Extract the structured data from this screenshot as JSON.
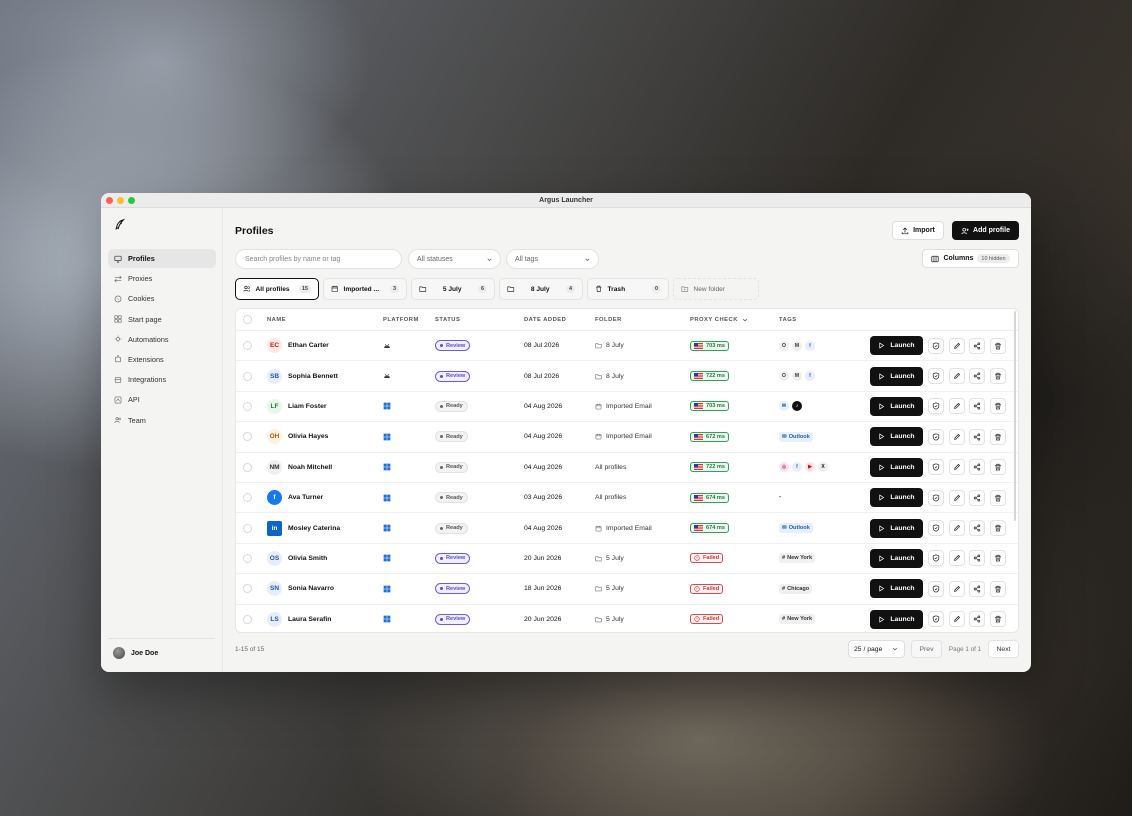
{
  "window": {
    "title": "Argus Launcher"
  },
  "sidebar": {
    "items": [
      {
        "label": "Profiles",
        "icon": "monitor-icon",
        "active": true
      },
      {
        "label": "Proxies",
        "icon": "proxy-icon"
      },
      {
        "label": "Cookies",
        "icon": "cookie-icon"
      },
      {
        "label": "Start page",
        "icon": "grid-icon"
      },
      {
        "label": "Automations",
        "icon": "automation-icon"
      },
      {
        "label": "Extensions",
        "icon": "extension-icon"
      },
      {
        "label": "Integrations",
        "icon": "integration-icon"
      },
      {
        "label": "API",
        "icon": "api-icon"
      },
      {
        "label": "Team",
        "icon": "team-icon"
      }
    ],
    "user": "Joe Doe"
  },
  "header": {
    "title": "Profiles",
    "import_label": "Import",
    "add_label": "Add profile",
    "columns_label": "Columns",
    "hidden_label": "10 hidden"
  },
  "filters": {
    "search_placeholder": "Search profiles by name or tag",
    "status_select": "All statuses",
    "tags_select": "All tags"
  },
  "folders": [
    {
      "label": "All profiles",
      "count": "15",
      "icon": "users-icon",
      "active": true
    },
    {
      "label": "Imported ...",
      "count": "3",
      "icon": "calendar-icon"
    },
    {
      "label": "5 July",
      "count": "6",
      "icon": "folder-icon"
    },
    {
      "label": "8 July",
      "count": "4",
      "icon": "folder-icon"
    },
    {
      "label": "Trash",
      "count": "0",
      "icon": "trash-icon"
    },
    {
      "label": "New folder",
      "icon": "folder-plus-icon"
    }
  ],
  "table": {
    "headers": [
      "NAME",
      "PLATFORM",
      "STATUS",
      "DATE ADDED",
      "FOLDER",
      "PROXY CHECK",
      "TAGS"
    ],
    "rows": [
      {
        "initials": "EC",
        "avatarColor": "#fde8e8",
        "initialsColor": "#b42318",
        "name": "Ethan Carter",
        "platform": "android",
        "status": "Review",
        "date": "08 Jul 2026",
        "folder": "8 July",
        "folderIcon": "folder",
        "proxy": "703 ms",
        "proxyOk": true,
        "tags": [
          {
            "kind": "circle",
            "text": "O",
            "bg": "#efefef",
            "fg": "#333"
          },
          {
            "kind": "circle",
            "text": "M",
            "bg": "#efefef",
            "fg": "#333"
          },
          {
            "kind": "circle",
            "text": "f",
            "bg": "#e7f0fc",
            "fg": "#1877f2"
          }
        ],
        "launch": "Launch"
      },
      {
        "initials": "SB",
        "avatarColor": "#e7eefb",
        "initialsColor": "#2451a6",
        "name": "Sophia Bennett",
        "platform": "android",
        "status": "Review",
        "date": "08 Jul 2026",
        "folder": "8 July",
        "folderIcon": "folder",
        "proxy": "722 ms",
        "proxyOk": true,
        "tags": [
          {
            "kind": "circle",
            "text": "O",
            "bg": "#efefef",
            "fg": "#333"
          },
          {
            "kind": "circle",
            "text": "M",
            "bg": "#efefef",
            "fg": "#333"
          },
          {
            "kind": "circle",
            "text": "f",
            "bg": "#e7f0fc",
            "fg": "#1877f2"
          }
        ],
        "launch": "Launch"
      },
      {
        "initials": "LF",
        "avatarColor": "#e8f6ec",
        "initialsColor": "#1e7a3a",
        "name": "Liam Foster",
        "platform": "windows",
        "status": "Ready",
        "date": "04 Aug 2026",
        "folder": "Imported Email",
        "folderIcon": "calendar",
        "proxy": "703 ms",
        "proxyOk": true,
        "tags": [
          {
            "kind": "circle",
            "text": "✉",
            "bg": "#e7f0fc",
            "fg": "#1f5fb3"
          },
          {
            "kind": "circle",
            "text": "♪",
            "bg": "#111",
            "fg": "#fff"
          }
        ],
        "launch": "Launch"
      },
      {
        "initials": "OH",
        "avatarColor": "#fdf1e1",
        "initialsColor": "#b45a09",
        "name": "Olivia Hayes",
        "platform": "windows",
        "status": "Ready",
        "date": "04 Aug 2026",
        "folder": "Imported Email",
        "folderIcon": "calendar",
        "proxy": "672 ms",
        "proxyOk": true,
        "tags": [
          {
            "kind": "pill",
            "text": "Outlook",
            "style": "outlook"
          }
        ],
        "launch": "Launch"
      },
      {
        "initials": "NM",
        "avatarColor": "#efefef",
        "initialsColor": "#333",
        "name": "Noah Mitchell",
        "platform": "windows",
        "status": "Ready",
        "date": "04 Aug 2026",
        "folder": "All profiles",
        "folderIcon": "",
        "proxy": "722 ms",
        "proxyOk": true,
        "tags": [
          {
            "kind": "circle",
            "text": "◎",
            "bg": "#fbe4f1",
            "fg": "#d62976"
          },
          {
            "kind": "circle",
            "text": "f",
            "bg": "#e7f0fc",
            "fg": "#1877f2"
          },
          {
            "kind": "circle",
            "text": "▶",
            "bg": "#fde4e4",
            "fg": "#e00"
          },
          {
            "kind": "circle",
            "text": "X",
            "bg": "#efefef",
            "fg": "#111"
          }
        ],
        "launch": "Launch"
      },
      {
        "initials": "f",
        "avatarColor": "#1877f2",
        "initialsColor": "#fff",
        "name": "Ava Turner",
        "platform": "windows",
        "status": "Ready",
        "date": "03 Aug 2026",
        "folder": "All profiles",
        "folderIcon": "",
        "proxy": "674 ms",
        "proxyOk": true,
        "tags": [
          {
            "kind": "text",
            "text": "-"
          }
        ],
        "launch": "Launch"
      },
      {
        "initials": "in",
        "avatarColor": "#0a66c2",
        "initialsColor": "#fff",
        "name": "Mosley Caterina",
        "platform": "windows",
        "status": "Ready",
        "date": "04 Aug 2026",
        "folder": "Imported Email",
        "folderIcon": "calendar",
        "proxy": "674 ms",
        "proxyOk": true,
        "tags": [
          {
            "kind": "pill",
            "text": "Outlook",
            "style": "outlook"
          }
        ],
        "launch": "Launch"
      },
      {
        "initials": "OS",
        "avatarColor": "#e7eefb",
        "initialsColor": "#2451a6",
        "name": "Olivia Smith",
        "platform": "windows",
        "status": "Review",
        "date": "20 Jun 2026",
        "folder": "5 July",
        "folderIcon": "folder",
        "proxy": "Failed",
        "proxyOk": false,
        "tags": [
          {
            "kind": "pill",
            "text": "New York",
            "style": "city"
          }
        ],
        "launch": "Launch"
      },
      {
        "initials": "SN",
        "avatarColor": "#e7eefb",
        "initialsColor": "#2451a6",
        "name": "Sonia Navarro",
        "platform": "windows",
        "status": "Review",
        "date": "18 Jun 2026",
        "folder": "5 July",
        "folderIcon": "folder",
        "proxy": "Failed",
        "proxyOk": false,
        "tags": [
          {
            "kind": "pill",
            "text": "Chicago",
            "style": "city"
          }
        ],
        "launch": "Launch"
      },
      {
        "initials": "LS",
        "avatarColor": "#e7eefb",
        "initialsColor": "#2451a6",
        "name": "Laura Serafin",
        "platform": "windows",
        "status": "Review",
        "date": "20 Jun 2026",
        "folder": "5 July",
        "folderIcon": "folder",
        "proxy": "Failed",
        "proxyOk": false,
        "tags": [
          {
            "kind": "pill",
            "text": "New York",
            "style": "city"
          }
        ],
        "launch": "Launch"
      }
    ]
  },
  "footer": {
    "count": "1-15 of 15",
    "per_page": "25 / page",
    "prev": "Prev",
    "page_info": "Page 1 of 1",
    "next": "Next"
  }
}
